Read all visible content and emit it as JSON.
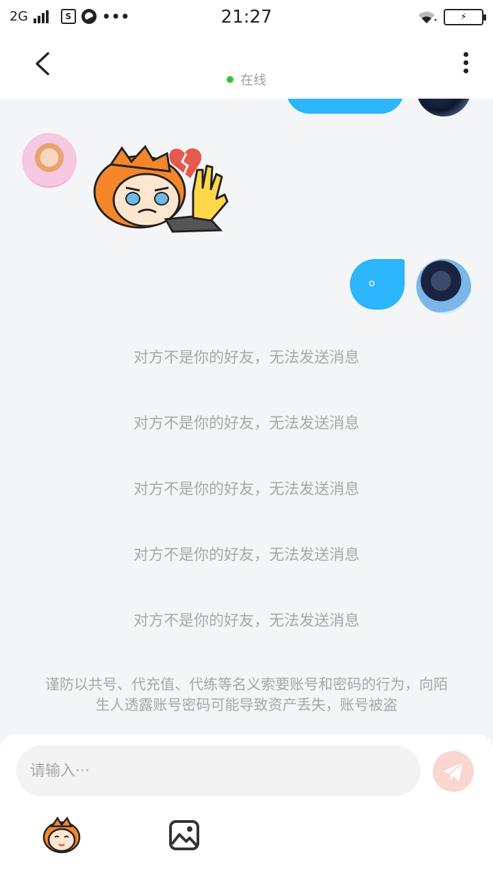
{
  "status_bar": {
    "network": "2G",
    "box_label": "S",
    "dots": "•••",
    "time": "21:27",
    "battery": "⚡"
  },
  "header": {
    "status_text": "在线",
    "status_color": "#32c532"
  },
  "colors": {
    "my_bubble": "#2cb6fb",
    "background": "#f4f5f7",
    "send_button": "#fbd5cf"
  },
  "messages": {
    "my_last_text": "。"
  },
  "system_notices": [
    "对方不是你的好友，无法发送消息",
    "对方不是你的好友，无法发送消息",
    "对方不是你的好友，无法发送消息",
    "对方不是你的好友，无法发送消息",
    "对方不是你的好友，无法发送消息"
  ],
  "warning": "谨防以共号、代充值、代练等名义索要账号和密码的行为，向陌生人透露账号密码可能导致资产丢失，账号被盗",
  "composer": {
    "placeholder": "请输入···",
    "send_icon": "paper-plane-icon",
    "emoji_icon": "emoji-mascot-icon",
    "image_icon": "image-icon"
  }
}
